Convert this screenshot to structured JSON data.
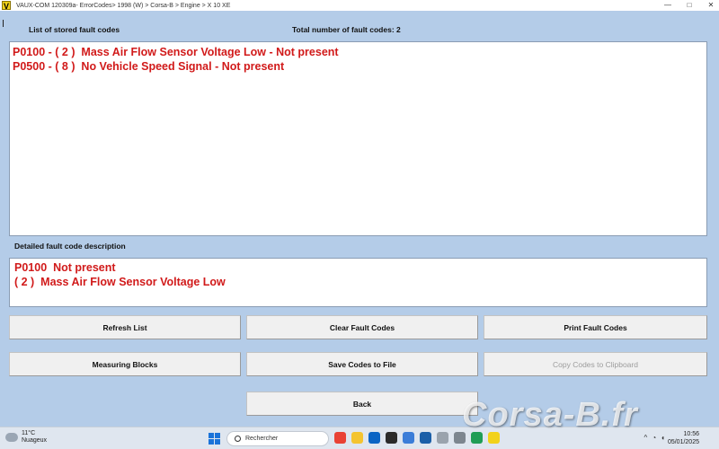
{
  "window": {
    "title": "VAUX-COM 120309a- ErrorCodes> 1998 (W) > Corsa-B > Engine > X 10 XE",
    "logo_letter": "V",
    "controls": [
      "—",
      "□",
      "✕"
    ]
  },
  "fault_list": {
    "heading": "List of stored fault codes",
    "total_label": "Total number of fault codes:",
    "total_value": "2",
    "codes": [
      "P0100 - ( 2 )  Mass Air Flow Sensor Voltage Low - Not present",
      "P0500 - ( 8 )  No Vehicle Speed Signal - Not present"
    ]
  },
  "detail": {
    "heading": "Detailed fault code description",
    "lines": [
      "P0100  Not present",
      "( 2 )  Mass Air Flow Sensor Voltage Low"
    ]
  },
  "buttons": {
    "refresh": "Refresh List",
    "clear": "Clear Fault Codes",
    "print": "Print Fault Codes",
    "measuring": "Measuring Blocks",
    "save": "Save Codes to File",
    "copy": "Copy Codes to Clipboard",
    "back": "Back"
  },
  "taskbar": {
    "weather_temp": "11°C",
    "weather_condition": "Nuageux",
    "search_placeholder": "Rechercher",
    "time": "10:56",
    "date": "05/01/2025",
    "app_icons": [
      {
        "name": "chrome-icon",
        "color": "#e94235"
      },
      {
        "name": "file-explorer-icon",
        "color": "#f4c430"
      },
      {
        "name": "outlook-icon",
        "color": "#0a64c4"
      },
      {
        "name": "photos-icon",
        "color": "#2b2b2b"
      },
      {
        "name": "store-icon",
        "color": "#3b7dd8"
      },
      {
        "name": "app-l-icon",
        "color": "#1b5fa8"
      },
      {
        "name": "app-gray-icon",
        "color": "#9aa3ad"
      },
      {
        "name": "app-gray2-icon",
        "color": "#7d868f"
      },
      {
        "name": "app-green-icon",
        "color": "#1f9d55"
      },
      {
        "name": "vauxcom-icon",
        "color": "#f2d21a"
      }
    ]
  },
  "watermark": "Corsa-B.fr",
  "colors": {
    "background": "#b4cce8",
    "fault_text": "#d11a1a",
    "logo": "#f2d21a"
  }
}
